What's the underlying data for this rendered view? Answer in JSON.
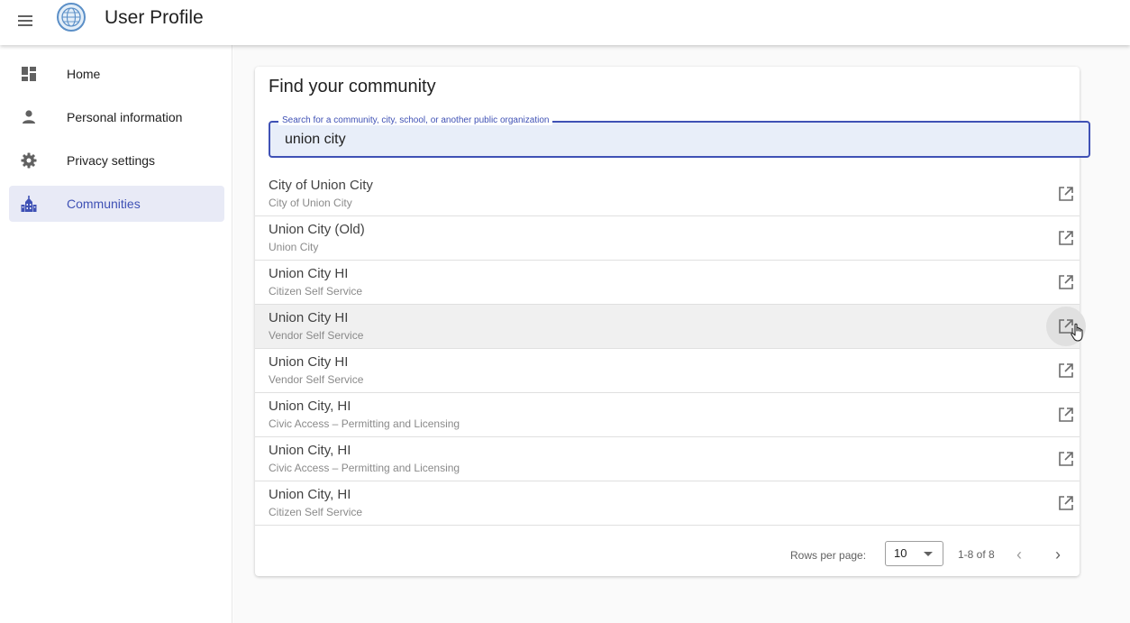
{
  "header": {
    "title": "User Profile",
    "menu_icon": "hamburger-menu-icon",
    "logo_icon": "globe-logo-icon"
  },
  "sidebar": {
    "items": [
      {
        "label": "Home",
        "icon": "dashboard-icon",
        "active": false
      },
      {
        "label": "Personal information",
        "icon": "person-icon",
        "active": false
      },
      {
        "label": "Privacy settings",
        "icon": "gear-icon",
        "active": false
      },
      {
        "label": "Communities",
        "icon": "city-building-icon",
        "active": true
      }
    ]
  },
  "main": {
    "title": "Find your community",
    "search": {
      "label": "Search for a community, city, school, or another public organization",
      "value": "union city"
    },
    "results": [
      {
        "title": "City of Union City",
        "subtitle": "City of Union City"
      },
      {
        "title": "Union City (Old)",
        "subtitle": "Union City"
      },
      {
        "title": "Union City HI",
        "subtitle": "Citizen Self Service"
      },
      {
        "title": "Union City HI",
        "subtitle": "Vendor Self Service"
      },
      {
        "title": "Union City HI",
        "subtitle": "Vendor Self Service"
      },
      {
        "title": "Union City, HI",
        "subtitle": "Civic Access – Permitting and Licensing"
      },
      {
        "title": "Union City, HI",
        "subtitle": "Civic Access – Permitting and Licensing"
      },
      {
        "title": "Union City, HI",
        "subtitle": "Citizen Self Service"
      }
    ],
    "pagination": {
      "rows_per_page_label": "Rows per page:",
      "rows_per_page": "10",
      "range": "1-8 of 8",
      "prev_glyph": "‹",
      "next_glyph": "›"
    }
  },
  "colors": {
    "accent": "#3f51b5",
    "active_bg": "#e8eaf6",
    "search_bg": "#e8eef9"
  }
}
